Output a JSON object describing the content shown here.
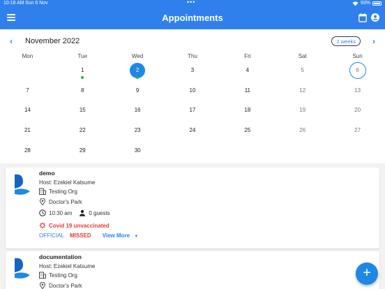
{
  "statusbar": {
    "time": "10:16 AM",
    "date": "Sun 6 Nov",
    "battery": "93%"
  },
  "appbar": {
    "title": "Appointments"
  },
  "calendar": {
    "month_label": "November 2022",
    "range_label": "2 weeks",
    "weekdays": [
      "Mon",
      "Tue",
      "Wed",
      "Thu",
      "Fri",
      "Sat",
      "Sun"
    ],
    "weeks": [
      [
        "",
        "1",
        "2",
        "3",
        "4",
        "5",
        "6"
      ],
      [
        "7",
        "8",
        "9",
        "10",
        "11",
        "12",
        "13"
      ],
      [
        "14",
        "15",
        "16",
        "17",
        "18",
        "19",
        "20"
      ],
      [
        "21",
        "22",
        "23",
        "24",
        "25",
        "26",
        "27"
      ],
      [
        "28",
        "29",
        "30",
        "",
        "",
        "",
        ""
      ]
    ],
    "today": "2",
    "selected": "6",
    "event_days": [
      "1",
      "2"
    ],
    "accent": "#1e88e5"
  },
  "appointments": [
    {
      "title": "demo",
      "host": "Host: Ezekiel Katsume",
      "org": "Testing Org",
      "location": "Doctor's Park",
      "time": "10:30 am",
      "guests": "0 guests",
      "warning": "Covid 19 unvaccinated",
      "type": "OFFICIAL",
      "status": "MISSED",
      "view_more": "View More"
    },
    {
      "title": "documentation",
      "host": "Host: Ezekiel Katsume",
      "org": "Testing Org",
      "location": "Doctor's Park"
    }
  ],
  "fab": {
    "label": "+"
  }
}
